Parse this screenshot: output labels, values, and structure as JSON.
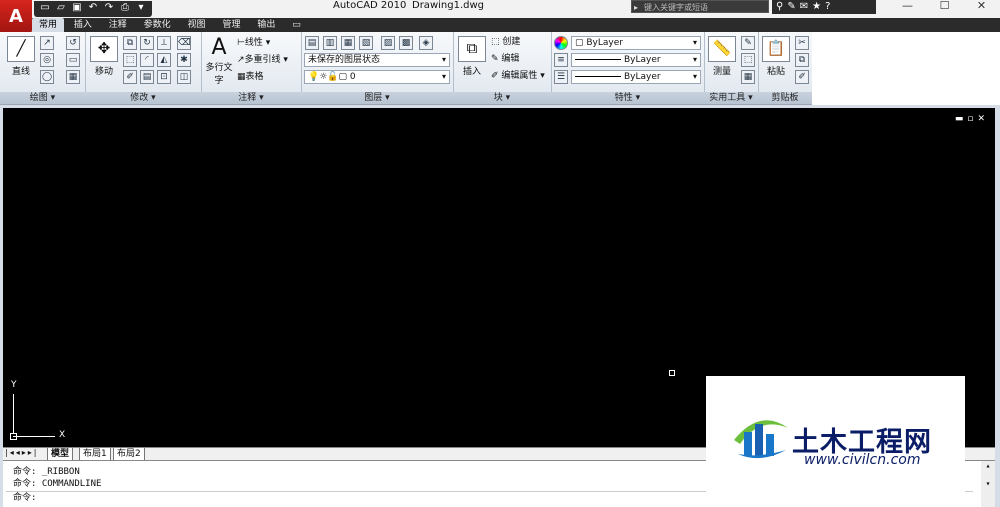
{
  "titlebar": {
    "app_title": "AutoCAD 2010",
    "file_title": "Drawing1.dwg",
    "search_placeholder": "键入关键字或短语"
  },
  "tabs": [
    "常用",
    "插入",
    "注释",
    "参数化",
    "视图",
    "管理",
    "输出"
  ],
  "active_tab": "常用",
  "ribbon": {
    "draw": {
      "label": "绘图 ▾",
      "line_label": "直线"
    },
    "modify": {
      "label": "修改 ▾",
      "move_label": "移动"
    },
    "annotation": {
      "label": "注释 ▾",
      "mtext_label": "多行文字",
      "linear": "线性 ▾",
      "multileader": "多重引线 ▾",
      "table": "表格"
    },
    "layers": {
      "label": "图层 ▾",
      "state": "未保存的图层状态",
      "current": "0"
    },
    "block": {
      "label": "块 ▾",
      "insert": "插入",
      "create": "创建",
      "edit": "编辑",
      "edit_attr": "编辑属性 ▾"
    },
    "properties": {
      "label": "特性 ▾",
      "color": "ByLayer",
      "linetype": "ByLayer",
      "lineweight": "ByLayer"
    },
    "utilities": {
      "label": "实用工具 ▾",
      "measure": "测量"
    },
    "clipboard": {
      "label": "剪贴板",
      "paste": "粘贴"
    }
  },
  "viewport": {
    "y_axis": "Y",
    "x_axis": "X"
  },
  "layout_tabs": [
    "模型",
    "布局1",
    "布局2"
  ],
  "command": {
    "history": [
      "命令: _RIBBON",
      "命令: COMMANDLINE"
    ],
    "prompt": "命令:"
  },
  "watermark": {
    "title": "土木工程网",
    "url": "www.civilcn.com"
  },
  "colors": {
    "accent": "#d7251e",
    "canvas": "#000000",
    "brand": "#0a1d66"
  }
}
